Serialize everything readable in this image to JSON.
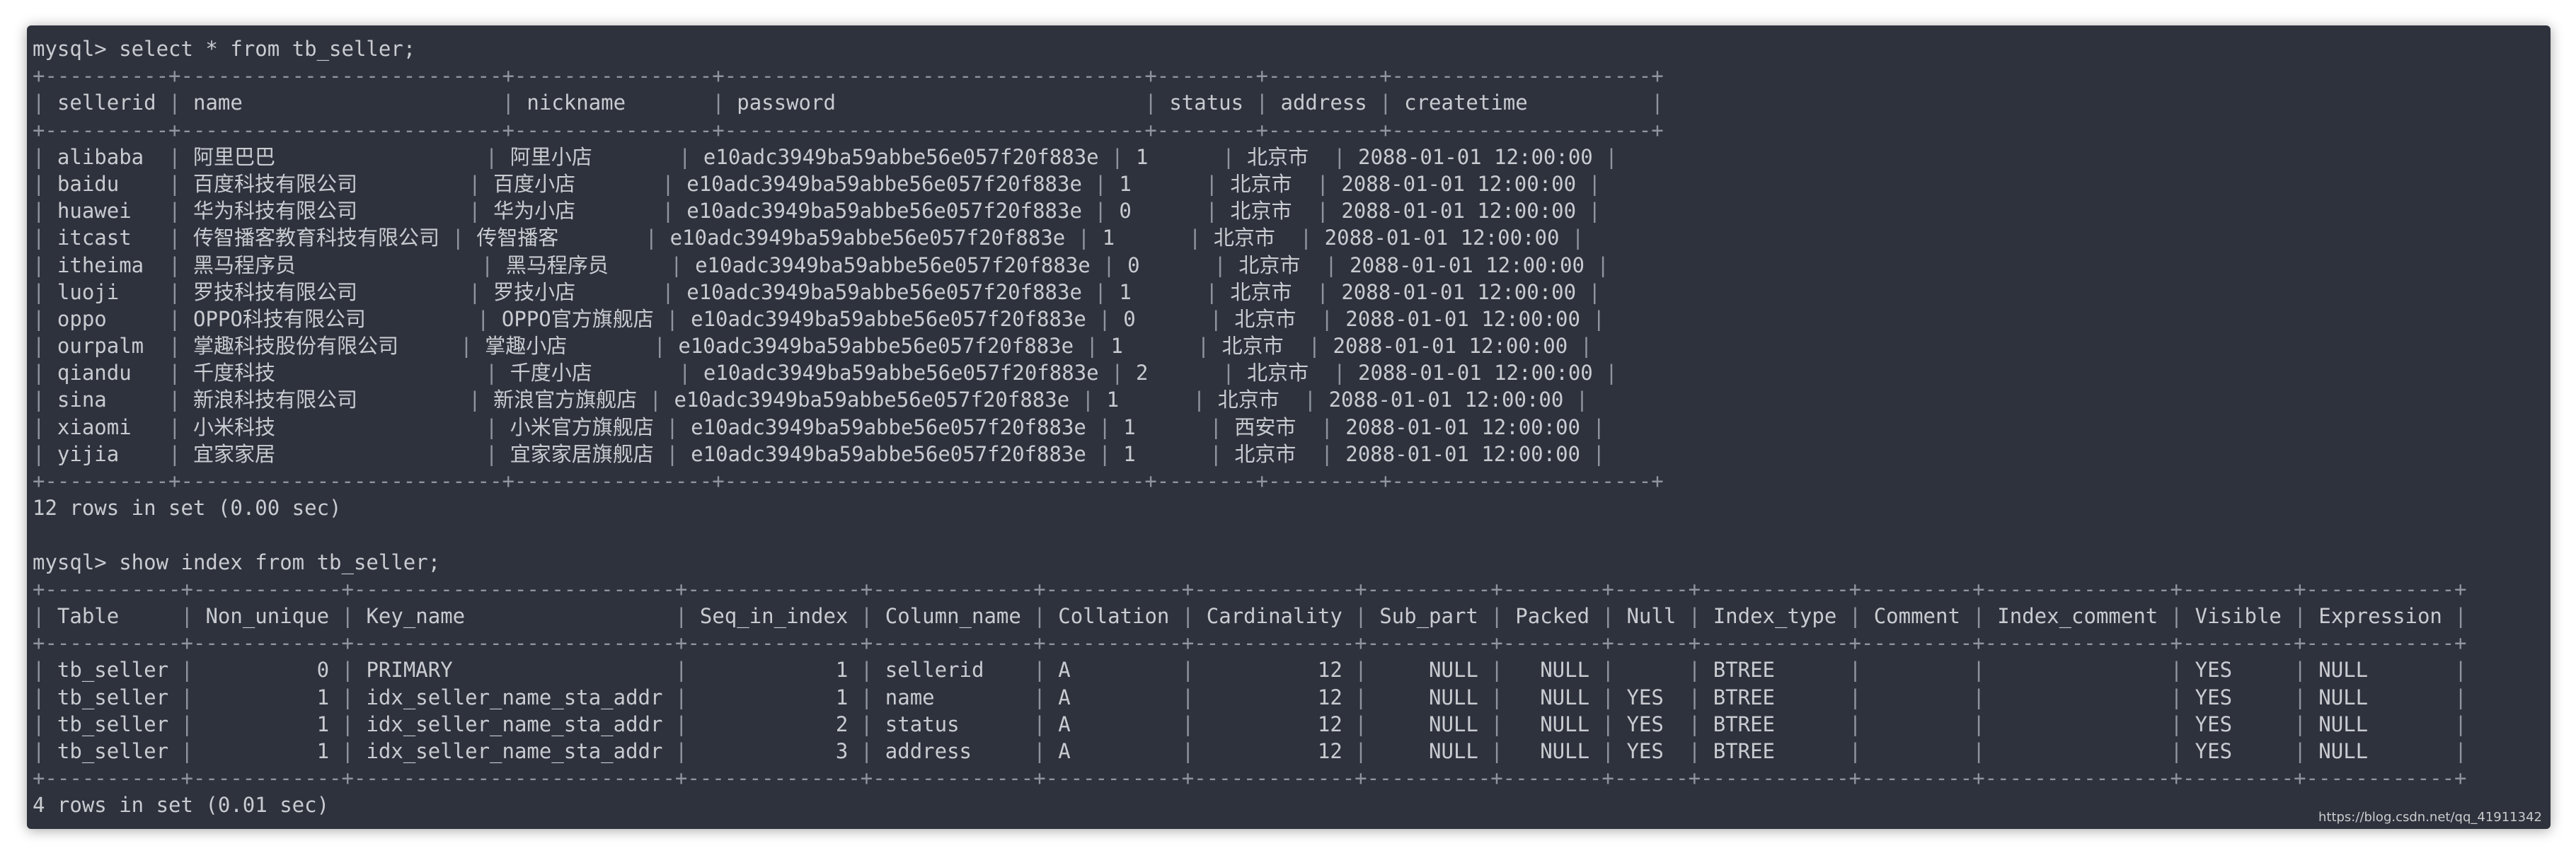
{
  "colors": {
    "page_background": "#ffffff",
    "terminal_background": "#2d323d",
    "text": "#c9cbd0",
    "table_border": "#8f949d"
  },
  "terminal": {
    "prompt": "mysql> ",
    "commands": [
      {
        "query": "select * from tb_seller;",
        "result": {
          "columns": [
            "sellerid",
            "name",
            "nickname",
            "password",
            "status",
            "address",
            "createtime"
          ],
          "rows": [
            [
              "alibaba",
              "阿里巴巴",
              "阿里小店",
              "e10adc3949ba59abbe56e057f20f883e",
              "1",
              "北京市",
              "2088-01-01 12:00:00"
            ],
            [
              "baidu",
              "百度科技有限公司",
              "百度小店",
              "e10adc3949ba59abbe56e057f20f883e",
              "1",
              "北京市",
              "2088-01-01 12:00:00"
            ],
            [
              "huawei",
              "华为科技有限公司",
              "华为小店",
              "e10adc3949ba59abbe56e057f20f883e",
              "0",
              "北京市",
              "2088-01-01 12:00:00"
            ],
            [
              "itcast",
              "传智播客教育科技有限公司",
              "传智播客",
              "e10adc3949ba59abbe56e057f20f883e",
              "1",
              "北京市",
              "2088-01-01 12:00:00"
            ],
            [
              "itheima",
              "黑马程序员",
              "黑马程序员",
              "e10adc3949ba59abbe56e057f20f883e",
              "0",
              "北京市",
              "2088-01-01 12:00:00"
            ],
            [
              "luoji",
              "罗技科技有限公司",
              "罗技小店",
              "e10adc3949ba59abbe56e057f20f883e",
              "1",
              "北京市",
              "2088-01-01 12:00:00"
            ],
            [
              "oppo",
              "OPPO科技有限公司",
              "OPPO官方旗舰店",
              "e10adc3949ba59abbe56e057f20f883e",
              "0",
              "北京市",
              "2088-01-01 12:00:00"
            ],
            [
              "ourpalm",
              "掌趣科技股份有限公司",
              "掌趣小店",
              "e10adc3949ba59abbe56e057f20f883e",
              "1",
              "北京市",
              "2088-01-01 12:00:00"
            ],
            [
              "qiandu",
              "千度科技",
              "千度小店",
              "e10adc3949ba59abbe56e057f20f883e",
              "2",
              "北京市",
              "2088-01-01 12:00:00"
            ],
            [
              "sina",
              "新浪科技有限公司",
              "新浪官方旗舰店",
              "e10adc3949ba59abbe56e057f20f883e",
              "1",
              "北京市",
              "2088-01-01 12:00:00"
            ],
            [
              "xiaomi",
              "小米科技",
              "小米官方旗舰店",
              "e10adc3949ba59abbe56e057f20f883e",
              "1",
              "西安市",
              "2088-01-01 12:00:00"
            ],
            [
              "yijia",
              "宜家家居",
              "宜家家居旗舰店",
              "e10adc3949ba59abbe56e057f20f883e",
              "1",
              "北京市",
              "2088-01-01 12:00:00"
            ]
          ]
        },
        "summary": "12 rows in set (0.00 sec)"
      },
      {
        "query": "show index from tb_seller;",
        "result": {
          "columns": [
            "Table",
            "Non_unique",
            "Key_name",
            "Seq_in_index",
            "Column_name",
            "Collation",
            "Cardinality",
            "Sub_part",
            "Packed",
            "Null",
            "Index_type",
            "Comment",
            "Index_comment",
            "Visible",
            "Expression"
          ],
          "right_aligned_columns": [
            1,
            3,
            6,
            7,
            8
          ],
          "rows": [
            [
              "tb_seller",
              "0",
              "PRIMARY",
              "1",
              "sellerid",
              "A",
              "12",
              "NULL",
              "NULL",
              "",
              "BTREE",
              "",
              "",
              "YES",
              "NULL"
            ],
            [
              "tb_seller",
              "1",
              "idx_seller_name_sta_addr",
              "1",
              "name",
              "A",
              "12",
              "NULL",
              "NULL",
              "YES",
              "BTREE",
              "",
              "",
              "YES",
              "NULL"
            ],
            [
              "tb_seller",
              "1",
              "idx_seller_name_sta_addr",
              "2",
              "status",
              "A",
              "12",
              "NULL",
              "NULL",
              "YES",
              "BTREE",
              "",
              "",
              "YES",
              "NULL"
            ],
            [
              "tb_seller",
              "1",
              "idx_seller_name_sta_addr",
              "3",
              "address",
              "A",
              "12",
              "NULL",
              "NULL",
              "YES",
              "BTREE",
              "",
              "",
              "YES",
              "NULL"
            ]
          ]
        },
        "summary": "4 rows in set (0.01 sec)"
      }
    ]
  },
  "watermark": "https://blog.csdn.net/qq_41911342"
}
